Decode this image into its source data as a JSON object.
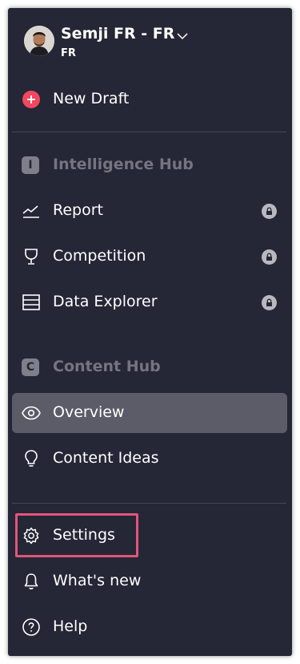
{
  "workspace": {
    "name": "Semji FR - FR",
    "subtitle": "FR"
  },
  "actions": {
    "new_draft": "New Draft"
  },
  "intelligence_hub": {
    "badge": "I",
    "title": "Intelligence Hub",
    "items": [
      {
        "label": "Report",
        "icon": "chart-line-icon",
        "locked": true
      },
      {
        "label": "Competition",
        "icon": "trophy-icon",
        "locked": true
      },
      {
        "label": "Data Explorer",
        "icon": "list-icon",
        "locked": true
      }
    ]
  },
  "content_hub": {
    "badge": "C",
    "title": "Content Hub",
    "items": [
      {
        "label": "Overview",
        "icon": "eye-icon",
        "active": true
      },
      {
        "label": "Content Ideas",
        "icon": "lightbulb-icon"
      }
    ]
  },
  "footer": {
    "items": [
      {
        "label": "Settings",
        "icon": "gear-icon",
        "highlighted": true
      },
      {
        "label": "What's new",
        "icon": "bell-icon"
      },
      {
        "label": "Help",
        "icon": "help-circle-icon"
      }
    ]
  },
  "colors": {
    "sidebar_bg": "#252636",
    "active_bg": "#5b5c68",
    "accent_pink": "#f2475e",
    "highlight_border": "#e2557b",
    "section_muted": "#74757f"
  }
}
